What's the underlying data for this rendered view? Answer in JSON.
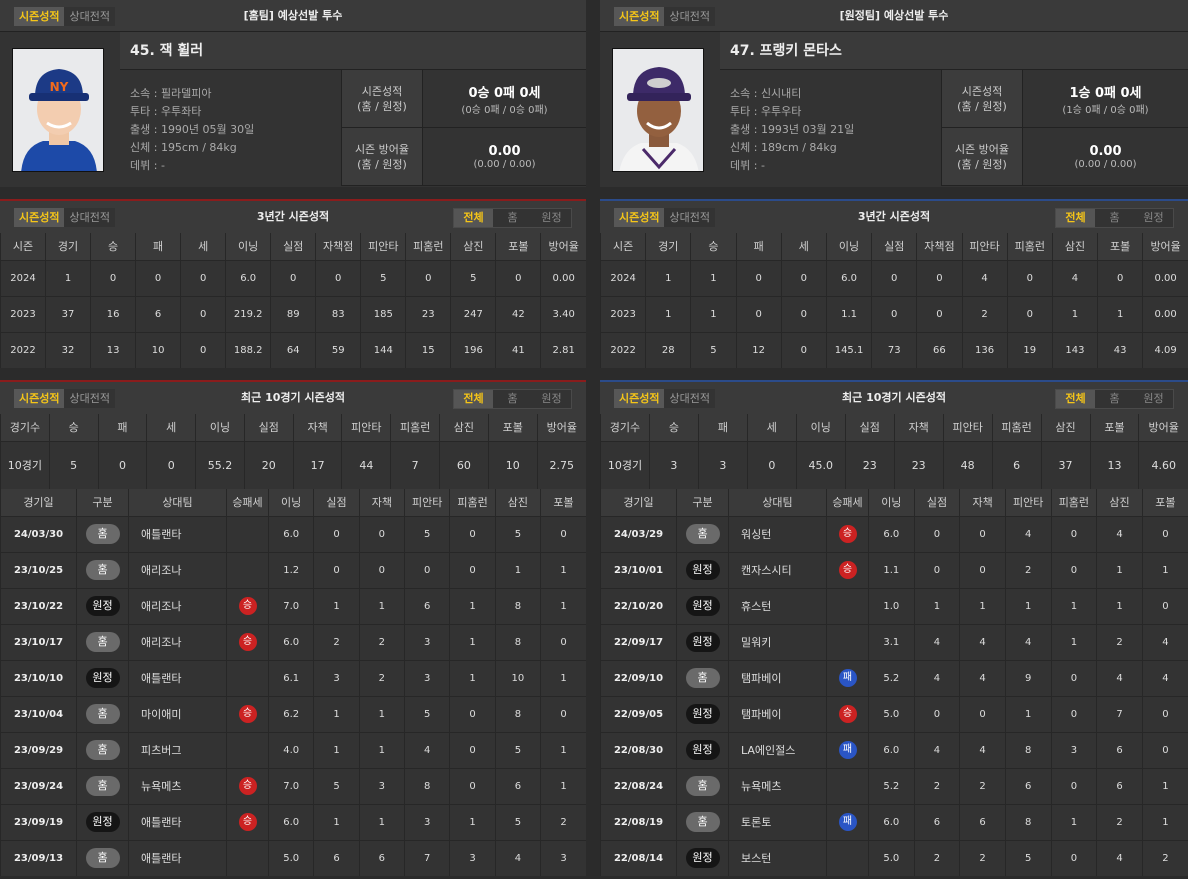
{
  "left": {
    "tabs": [
      "시즌성적",
      "상대전적"
    ],
    "header_title": "[홈팀] 예상선발 투수",
    "player": {
      "name": "45. 잭 휠러",
      "info": [
        "소속 : 필라델피아",
        "투타 : 우투좌타",
        "출생 : 1990년 05월 30일",
        "신체 : 195cm / 84kg",
        "데뷔 : -"
      ]
    },
    "season": {
      "k1a": "시즌성적",
      "k1b": "(홈 / 원정)",
      "v1": "0승 0패 0세",
      "s1": "(0승 0패 / 0승 0패)",
      "k2a": "시즌 방어율",
      "k2b": "(홈 / 원정)",
      "v2": "0.00",
      "s2": "(0.00 / 0.00)"
    },
    "three_year": {
      "title": "3년간 시즌성적",
      "filters": [
        "전체",
        "홈",
        "원정"
      ],
      "headers": [
        "시즌",
        "경기",
        "승",
        "패",
        "세",
        "이닝",
        "실점",
        "자책점",
        "피안타",
        "피홈런",
        "삼진",
        "포볼",
        "방어율"
      ],
      "rows": [
        [
          "2024",
          "1",
          "0",
          "0",
          "0",
          "6.0",
          "0",
          "0",
          "5",
          "0",
          "5",
          "0",
          "0.00"
        ],
        [
          "2023",
          "37",
          "16",
          "6",
          "0",
          "219.2",
          "89",
          "83",
          "185",
          "23",
          "247",
          "42",
          "3.40"
        ],
        [
          "2022",
          "32",
          "13",
          "10",
          "0",
          "188.2",
          "64",
          "59",
          "144",
          "15",
          "196",
          "41",
          "2.81"
        ]
      ]
    },
    "recent": {
      "title": "최근 10경기 시즌성적",
      "filters": [
        "전체",
        "홈",
        "원정"
      ],
      "sum_headers": [
        "경기수",
        "승",
        "패",
        "세",
        "이닝",
        "실점",
        "자책",
        "피안타",
        "피홈런",
        "삼진",
        "포볼",
        "방어율"
      ],
      "sum_row": [
        "10경기",
        "5",
        "0",
        "0",
        "55.2",
        "20",
        "17",
        "44",
        "7",
        "60",
        "10",
        "2.75"
      ],
      "game_headers": [
        "경기일",
        "구분",
        "상대팀",
        "승패세",
        "이닝",
        "실점",
        "자책",
        "피안타",
        "피홈런",
        "삼진",
        "포볼"
      ],
      "games": [
        {
          "date": "24/03/30",
          "type": "홈",
          "opp": "애틀랜타",
          "dec": "",
          "stats": [
            "6.0",
            "0",
            "0",
            "5",
            "0",
            "5",
            "0"
          ]
        },
        {
          "date": "23/10/25",
          "type": "홈",
          "opp": "애리조나",
          "dec": "",
          "stats": [
            "1.2",
            "0",
            "0",
            "0",
            "0",
            "1",
            "1"
          ]
        },
        {
          "date": "23/10/22",
          "type": "원정",
          "opp": "애리조나",
          "dec": "승",
          "stats": [
            "7.0",
            "1",
            "1",
            "6",
            "1",
            "8",
            "1"
          ]
        },
        {
          "date": "23/10/17",
          "type": "홈",
          "opp": "애리조나",
          "dec": "승",
          "stats": [
            "6.0",
            "2",
            "2",
            "3",
            "1",
            "8",
            "0"
          ]
        },
        {
          "date": "23/10/10",
          "type": "원정",
          "opp": "애틀랜타",
          "dec": "",
          "stats": [
            "6.1",
            "3",
            "2",
            "3",
            "1",
            "10",
            "1"
          ]
        },
        {
          "date": "23/10/04",
          "type": "홈",
          "opp": "마이애미",
          "dec": "승",
          "stats": [
            "6.2",
            "1",
            "1",
            "5",
            "0",
            "8",
            "0"
          ]
        },
        {
          "date": "23/09/29",
          "type": "홈",
          "opp": "피츠버그",
          "dec": "",
          "stats": [
            "4.0",
            "1",
            "1",
            "4",
            "0",
            "5",
            "1"
          ]
        },
        {
          "date": "23/09/24",
          "type": "홈",
          "opp": "뉴욕메츠",
          "dec": "승",
          "stats": [
            "7.0",
            "5",
            "3",
            "8",
            "0",
            "6",
            "1"
          ]
        },
        {
          "date": "23/09/19",
          "type": "원정",
          "opp": "애틀랜타",
          "dec": "승",
          "stats": [
            "6.0",
            "1",
            "1",
            "3",
            "1",
            "5",
            "2"
          ]
        },
        {
          "date": "23/09/13",
          "type": "홈",
          "opp": "애틀랜타",
          "dec": "",
          "stats": [
            "5.0",
            "6",
            "6",
            "7",
            "3",
            "4",
            "3"
          ]
        }
      ]
    }
  },
  "right": {
    "tabs": [
      "시즌성적",
      "상대전적"
    ],
    "header_title": "[원정팀] 예상선발 투수",
    "player": {
      "name": "47. 프랭키 몬타스",
      "info": [
        "소속 : 신시내티",
        "투타 : 우투우타",
        "출생 : 1993년 03월 21일",
        "신체 : 189cm / 84kg",
        "데뷔 : -"
      ]
    },
    "season": {
      "k1a": "시즌성적",
      "k1b": "(홈 / 원정)",
      "v1": "1승 0패 0세",
      "s1": "(1승 0패 / 0승 0패)",
      "k2a": "시즌 방어율",
      "k2b": "(홈 / 원정)",
      "v2": "0.00",
      "s2": "(0.00 / 0.00)"
    },
    "three_year": {
      "title": "3년간 시즌성적",
      "filters": [
        "전체",
        "홈",
        "원정"
      ],
      "headers": [
        "시즌",
        "경기",
        "승",
        "패",
        "세",
        "이닝",
        "실점",
        "자책점",
        "피안타",
        "피홈런",
        "삼진",
        "포볼",
        "방어율"
      ],
      "rows": [
        [
          "2024",
          "1",
          "1",
          "0",
          "0",
          "6.0",
          "0",
          "0",
          "4",
          "0",
          "4",
          "0",
          "0.00"
        ],
        [
          "2023",
          "1",
          "1",
          "0",
          "0",
          "1.1",
          "0",
          "0",
          "2",
          "0",
          "1",
          "1",
          "0.00"
        ],
        [
          "2022",
          "28",
          "5",
          "12",
          "0",
          "145.1",
          "73",
          "66",
          "136",
          "19",
          "143",
          "43",
          "4.09"
        ]
      ]
    },
    "recent": {
      "title": "최근 10경기 시즌성적",
      "filters": [
        "전체",
        "홈",
        "원정"
      ],
      "sum_headers": [
        "경기수",
        "승",
        "패",
        "세",
        "이닝",
        "실점",
        "자책",
        "피안타",
        "피홈런",
        "삼진",
        "포볼",
        "방어율"
      ],
      "sum_row": [
        "10경기",
        "3",
        "3",
        "0",
        "45.0",
        "23",
        "23",
        "48",
        "6",
        "37",
        "13",
        "4.60"
      ],
      "game_headers": [
        "경기일",
        "구분",
        "상대팀",
        "승패세",
        "이닝",
        "실점",
        "자책",
        "피안타",
        "피홈런",
        "삼진",
        "포볼"
      ],
      "games": [
        {
          "date": "24/03/29",
          "type": "홈",
          "opp": "워싱턴",
          "dec": "승",
          "stats": [
            "6.0",
            "0",
            "0",
            "4",
            "0",
            "4",
            "0"
          ]
        },
        {
          "date": "23/10/01",
          "type": "원정",
          "opp": "캔자스시티",
          "dec": "승",
          "stats": [
            "1.1",
            "0",
            "0",
            "2",
            "0",
            "1",
            "1"
          ]
        },
        {
          "date": "22/10/20",
          "type": "원정",
          "opp": "휴스턴",
          "dec": "",
          "stats": [
            "1.0",
            "1",
            "1",
            "1",
            "1",
            "1",
            "0"
          ]
        },
        {
          "date": "22/09/17",
          "type": "원정",
          "opp": "밀워키",
          "dec": "",
          "stats": [
            "3.1",
            "4",
            "4",
            "4",
            "1",
            "2",
            "4"
          ]
        },
        {
          "date": "22/09/10",
          "type": "홈",
          "opp": "탬파베이",
          "dec": "패",
          "stats": [
            "5.2",
            "4",
            "4",
            "9",
            "0",
            "4",
            "4"
          ]
        },
        {
          "date": "22/09/05",
          "type": "원정",
          "opp": "탬파베이",
          "dec": "승",
          "stats": [
            "5.0",
            "0",
            "0",
            "1",
            "0",
            "7",
            "0"
          ]
        },
        {
          "date": "22/08/30",
          "type": "원정",
          "opp": "LA에인절스",
          "dec": "패",
          "stats": [
            "6.0",
            "4",
            "4",
            "8",
            "3",
            "6",
            "0"
          ]
        },
        {
          "date": "22/08/24",
          "type": "홈",
          "opp": "뉴욕메츠",
          "dec": "",
          "stats": [
            "5.2",
            "2",
            "2",
            "6",
            "0",
            "6",
            "1"
          ]
        },
        {
          "date": "22/08/19",
          "type": "홈",
          "opp": "토론토",
          "dec": "패",
          "stats": [
            "6.0",
            "6",
            "6",
            "8",
            "1",
            "2",
            "1"
          ]
        },
        {
          "date": "22/08/14",
          "type": "원정",
          "opp": "보스턴",
          "dec": "",
          "stats": [
            "5.0",
            "2",
            "2",
            "5",
            "0",
            "4",
            "2"
          ]
        }
      ]
    }
  }
}
